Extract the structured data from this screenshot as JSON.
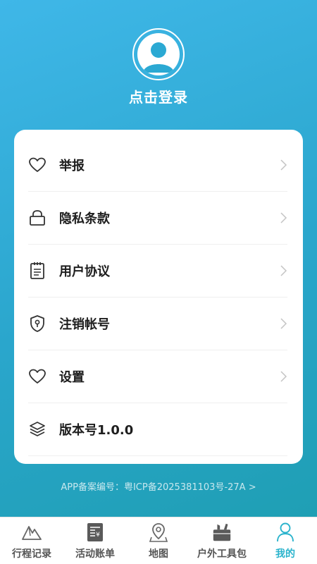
{
  "header": {
    "login_text": "点击登录"
  },
  "menu": {
    "items": [
      {
        "label": "举报",
        "icon": "heart-icon"
      },
      {
        "label": "隐私条款",
        "icon": "lock-icon"
      },
      {
        "label": "用户协议",
        "icon": "clipboard-icon"
      },
      {
        "label": "注销帐号",
        "icon": "shield-icon"
      },
      {
        "label": "设置",
        "icon": "heart-icon"
      },
      {
        "label": "版本号1.0.0",
        "icon": "layers-icon"
      }
    ]
  },
  "footer": {
    "icp_text": "APP备案编号：粤ICP备2025381103号-27A >"
  },
  "tabbar": {
    "tabs": [
      {
        "label": "行程记录",
        "icon": "mountain-icon"
      },
      {
        "label": "活动账单",
        "icon": "bill-icon"
      },
      {
        "label": "地图",
        "icon": "map-pin-icon"
      },
      {
        "label": "户外工具包",
        "icon": "toolbox-icon"
      },
      {
        "label": "我的",
        "icon": "user-icon",
        "active": true
      }
    ]
  },
  "colors": {
    "gradient_start": "#3fb7e8",
    "gradient_end": "#1f9fb4",
    "active_tab": "#2ab3cc"
  }
}
